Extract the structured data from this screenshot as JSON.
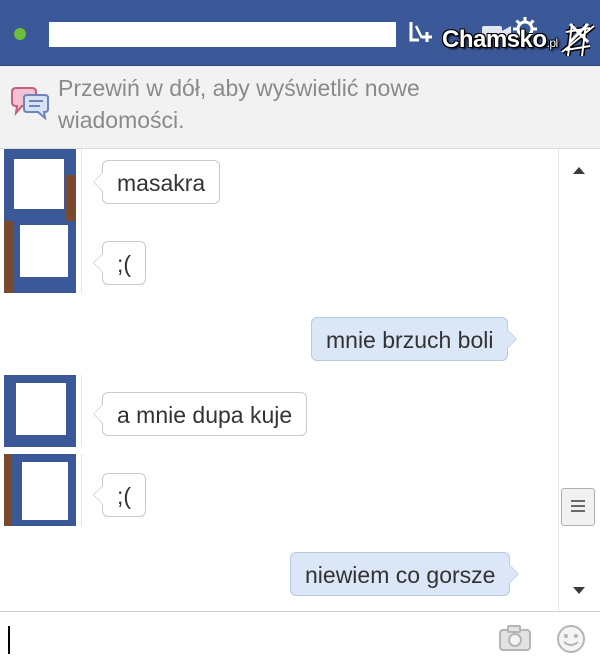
{
  "header": {
    "watermark_main": "Chamsko",
    "watermark_suffix": ".pl"
  },
  "notice": {
    "text": "Przewiń w dół, aby wyświetlić nowe wiadomości."
  },
  "messages": [
    {
      "direction": "incoming",
      "text": "masakra"
    },
    {
      "direction": "incoming",
      "text": ";("
    },
    {
      "direction": "outgoing",
      "text": "mnie brzuch boli"
    },
    {
      "direction": "incoming",
      "text": "a mnie dupa kuje"
    },
    {
      "direction": "incoming",
      "text": ";("
    },
    {
      "direction": "outgoing",
      "text": "niewiem co gorsze"
    }
  ],
  "composer": {
    "value": ""
  },
  "icons": {
    "header": [
      "online-status-icon",
      "add-friend-icon",
      "video-call-icon",
      "settings-gear-icon",
      "close-icon"
    ],
    "notice": "chat-bubbles-icon",
    "composer": [
      "camera-icon",
      "emoticon-icon"
    ]
  },
  "colors": {
    "header_bg": "#3b5998",
    "online": "#6bbf3a",
    "incoming_bubble": "#ffffff",
    "outgoing_bubble": "#dbe6f6",
    "notice_bg": "#f2f2f2"
  }
}
